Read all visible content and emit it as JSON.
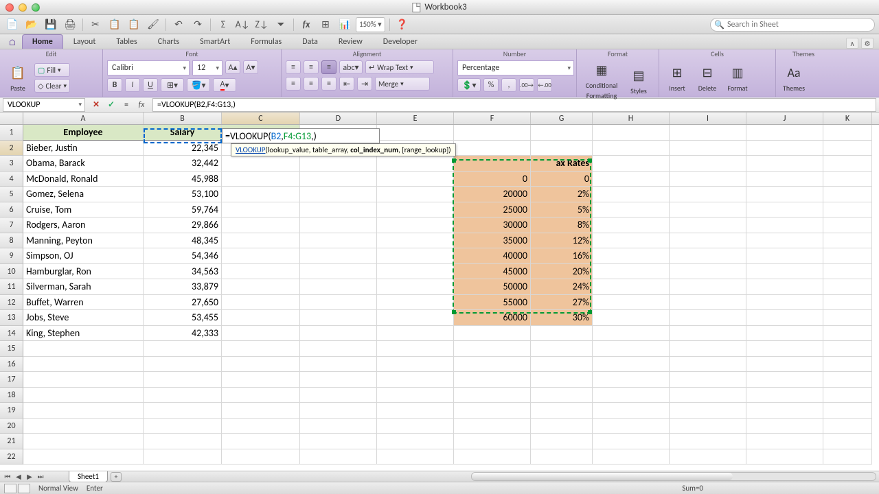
{
  "window": {
    "title": "Workbook3"
  },
  "search": {
    "placeholder": "Search in Sheet"
  },
  "ribbon": {
    "tabs": [
      "Home",
      "Layout",
      "Tables",
      "Charts",
      "SmartArt",
      "Formulas",
      "Data",
      "Review",
      "Developer"
    ],
    "active": "Home",
    "groups": {
      "edit": "Edit",
      "font": "Font",
      "alignment": "Alignment",
      "number": "Number",
      "format": "Format",
      "cells": "Cells",
      "themes": "Themes"
    },
    "edit": {
      "paste": "Paste",
      "fill": "Fill",
      "clear": "Clear"
    },
    "font": {
      "name": "Calibri",
      "size": "12"
    },
    "alignment": {
      "wrap": "Wrap Text",
      "merge": "Merge"
    },
    "number": {
      "format": "Percentage"
    },
    "format": {
      "conditional_line1": "Conditional",
      "conditional_line2": "Formatting",
      "styles": "Styles"
    },
    "cells": {
      "insert": "Insert",
      "delete": "Delete",
      "format": "Format"
    },
    "themes": {
      "themes": "Themes"
    }
  },
  "formula_bar": {
    "namebox": "VLOOKUP",
    "formula": "=VLOOKUP(B2,F4:G13,)",
    "edit_prefix": "=VLOOKUP(",
    "edit_arg1": "B2",
    "edit_comma": ",",
    "edit_arg2": "F4:G13",
    "edit_suffix": ",)",
    "tooltip_fn": "VLOOKUP",
    "tooltip_sig": "(lookup_value, table_array, ",
    "tooltip_bold": "col_index_num",
    "tooltip_rest": ", [range_lookup])"
  },
  "columns": [
    "A",
    "B",
    "C",
    "D",
    "E",
    "F",
    "G",
    "H",
    "I",
    "J",
    "K"
  ],
  "headers": {
    "employee": "Employee",
    "salary": "Salary",
    "taxrate": "Tax Rate"
  },
  "tax_title": "ax Rates",
  "employees": [
    {
      "name": "Bieber, Justin",
      "salary": "22,345"
    },
    {
      "name": "Obama, Barack",
      "salary": "32,442"
    },
    {
      "name": "McDonald, Ronald",
      "salary": "45,988"
    },
    {
      "name": "Gomez, Selena",
      "salary": "53,100"
    },
    {
      "name": "Cruise, Tom",
      "salary": "59,764"
    },
    {
      "name": "Rodgers, Aaron",
      "salary": "29,866"
    },
    {
      "name": "Manning, Peyton",
      "salary": "48,345"
    },
    {
      "name": "Simpson, OJ",
      "salary": "54,346"
    },
    {
      "name": "Hamburglar, Ron",
      "salary": "34,563"
    },
    {
      "name": "Silverman, Sarah",
      "salary": "33,879"
    },
    {
      "name": "Buffet, Warren",
      "salary": "27,650"
    },
    {
      "name": "Jobs, Steve",
      "salary": "53,455"
    },
    {
      "name": "King, Stephen",
      "salary": "42,333"
    }
  ],
  "tax_table": [
    {
      "threshold": "0",
      "rate": "0"
    },
    {
      "threshold": "20000",
      "rate": "2%"
    },
    {
      "threshold": "25000",
      "rate": "5%"
    },
    {
      "threshold": "30000",
      "rate": "8%"
    },
    {
      "threshold": "35000",
      "rate": "12%"
    },
    {
      "threshold": "40000",
      "rate": "16%"
    },
    {
      "threshold": "45000",
      "rate": "20%"
    },
    {
      "threshold": "50000",
      "rate": "24%"
    },
    {
      "threshold": "55000",
      "rate": "27%"
    },
    {
      "threshold": "60000",
      "rate": "30%"
    }
  ],
  "sheets": {
    "sheet1": "Sheet1"
  },
  "status": {
    "view": "Normal View",
    "mode": "Enter",
    "sum": "Sum=0"
  }
}
